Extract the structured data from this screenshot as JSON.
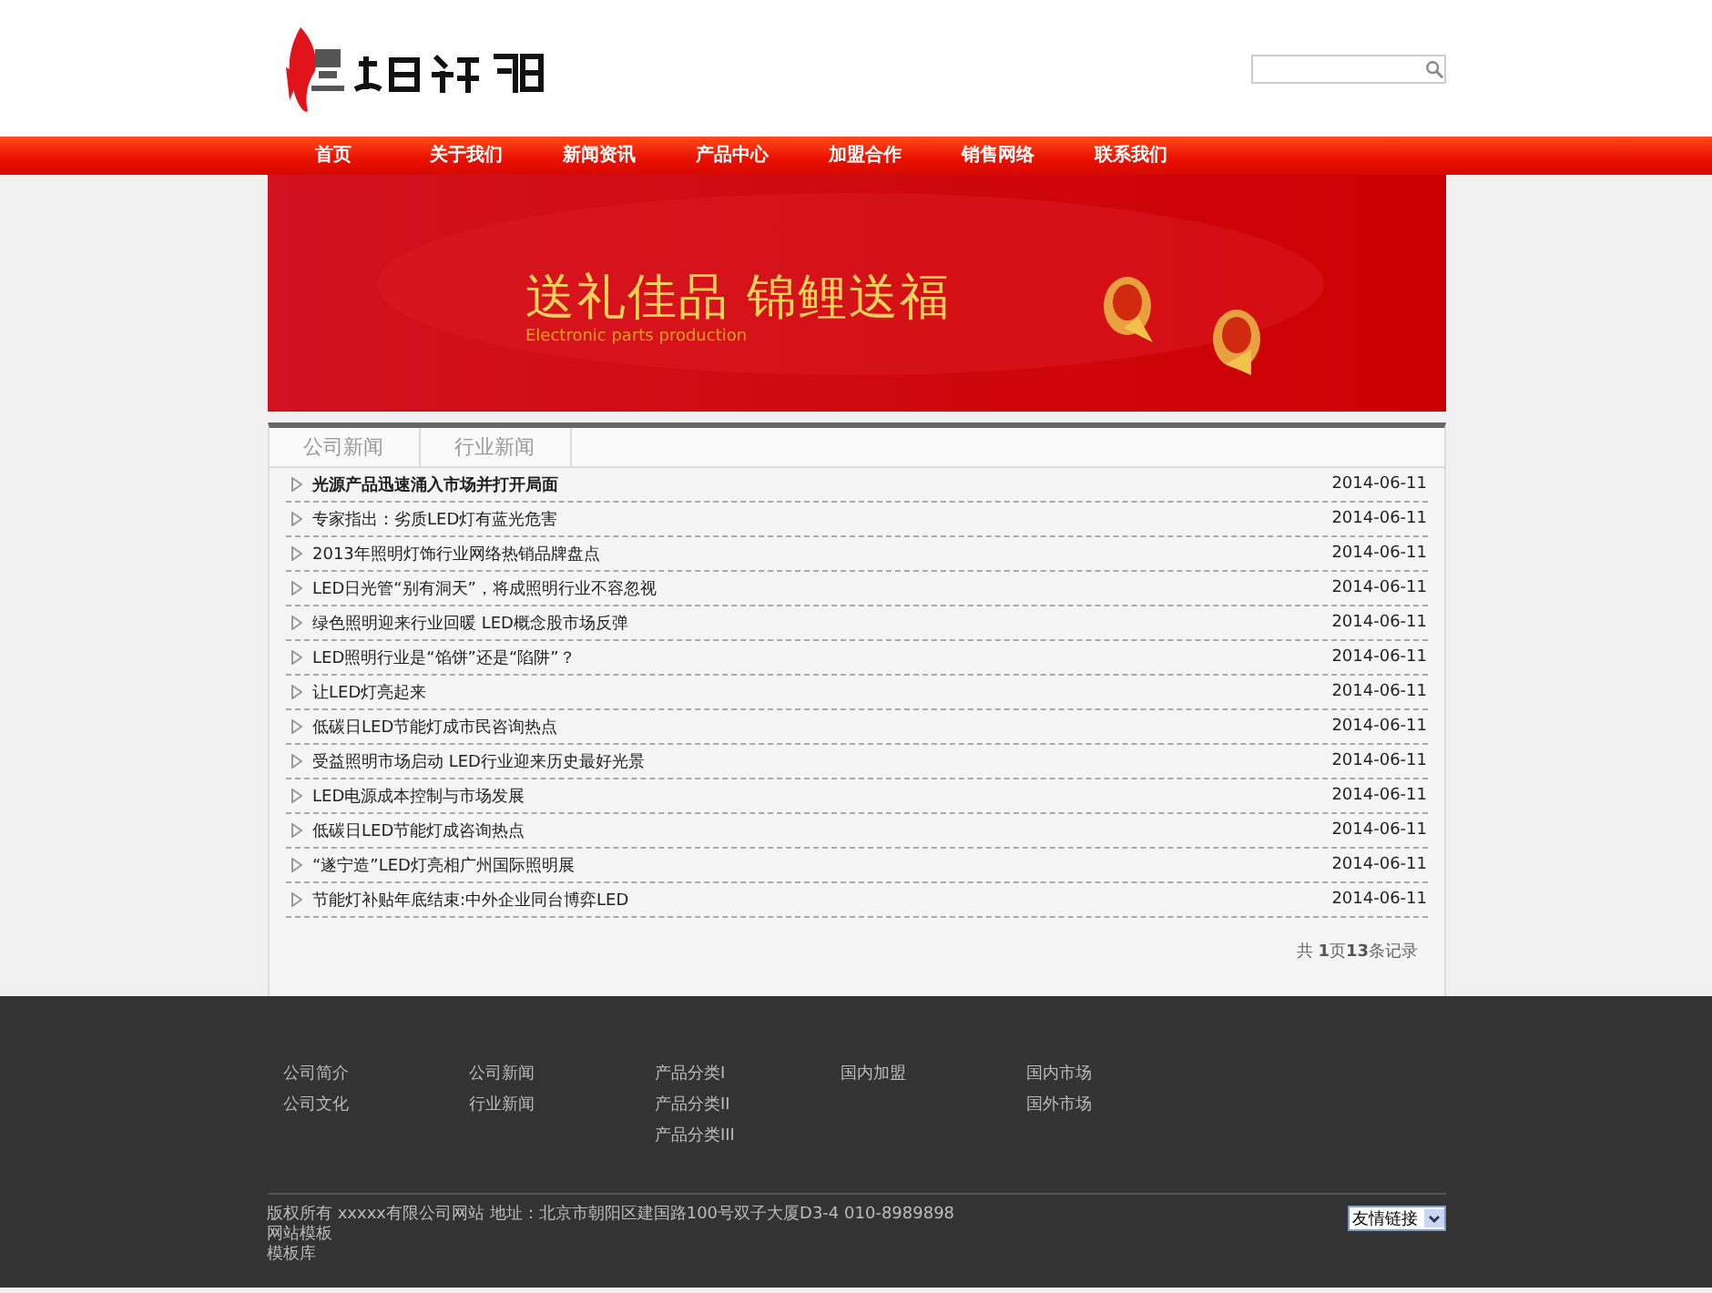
{
  "nav": [
    {
      "label": "首页"
    },
    {
      "label": "关于我们"
    },
    {
      "label": "新闻资讯"
    },
    {
      "label": "产品中心"
    },
    {
      "label": "加盟合作"
    },
    {
      "label": "销售网络"
    },
    {
      "label": "联系我们"
    }
  ],
  "banner": {
    "title": "送礼佳品 锦鲤送福",
    "subtitle": "Electronic parts production"
  },
  "tabs": [
    {
      "label": "公司新闻"
    },
    {
      "label": "行业新闻"
    }
  ],
  "news": [
    {
      "title": "光源产品迅速涌入市场并打开局面",
      "date": "2014-06-11",
      "bold": true
    },
    {
      "title": "专家指出：劣质LED灯有蓝光危害",
      "date": "2014-06-11",
      "bold": false
    },
    {
      "title": "2013年照明灯饰行业网络热销品牌盘点",
      "date": "2014-06-11",
      "bold": false
    },
    {
      "title": "LED日光管“别有洞天”，将成照明行业不容忽视",
      "date": "2014-06-11",
      "bold": false
    },
    {
      "title": "绿色照明迎来行业回暖 LED概念股市场反弹",
      "date": "2014-06-11",
      "bold": false
    },
    {
      "title": "LED照明行业是“馅饼”还是“陷阱”？",
      "date": "2014-06-11",
      "bold": false
    },
    {
      "title": "让LED灯亮起来",
      "date": "2014-06-11",
      "bold": false
    },
    {
      "title": "低碳日LED节能灯成市民咨询热点",
      "date": "2014-06-11",
      "bold": false
    },
    {
      "title": "受益照明市场启动 LED行业迎来历史最好光景",
      "date": "2014-06-11",
      "bold": false
    },
    {
      "title": "LED电源成本控制与市场发展",
      "date": "2014-06-11",
      "bold": false
    },
    {
      "title": "低碳日LED节能灯成咨询热点",
      "date": "2014-06-11",
      "bold": false
    },
    {
      "title": "“遂宁造”LED灯亮相广州国际照明展",
      "date": "2014-06-11",
      "bold": false
    },
    {
      "title": "节能灯补贴年底结束:中外企业同台博弈LED",
      "date": "2014-06-11",
      "bold": false
    }
  ],
  "pagination": "共 **1**页**13**条记录",
  "footer_columns": [
    [
      "公司简介",
      "公司文化"
    ],
    [
      "公司新闻",
      "行业新闻"
    ],
    [
      "产品分类I",
      "产品分类II",
      "产品分类III"
    ],
    [
      "国内加盟"
    ],
    [
      "国内市场",
      "国外市场"
    ]
  ],
  "copyright": [
    "版权所有 xxxxx有限公司网站 地址：北京市朝阳区建国路100号双子大厦D3-4 010-8989898",
    "网站模板",
    "模板库"
  ],
  "friend_links": {
    "value": "友情链接"
  }
}
